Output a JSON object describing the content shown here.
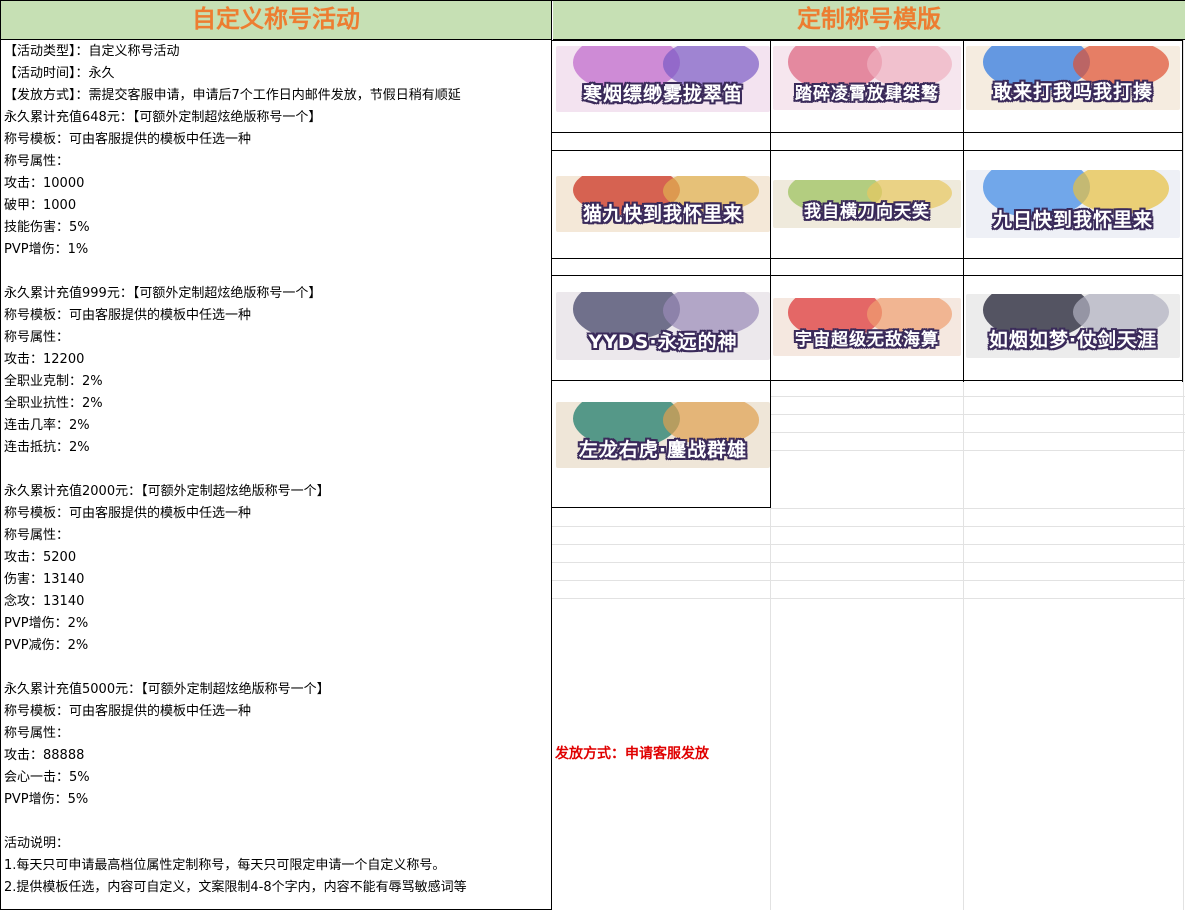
{
  "left_panel": {
    "title": "自定义称号活动",
    "lines": [
      "【活动类型】：自定义称号活动",
      "【活动时间】：永久",
      "【发放方式】：需提交客服申请，申请后7个工作日内邮件发放，节假日稍有顺延",
      "永久累计充值648元：【可额外定制超炫绝版称号一个】",
      "称号模板：可由客服提供的模板中任选一种",
      "称号属性：",
      "攻击：10000",
      "破甲：1000",
      "技能伤害：5%",
      "PVP增伤：1%",
      "",
      "永久累计充值999元：【可额外定制超炫绝版称号一个】",
      "称号模板：可由客服提供的模板中任选一种",
      "称号属性：",
      "攻击：12200",
      "全职业克制：2%",
      "全职业抗性：2%",
      "连击几率：2%",
      "连击抵抗：2%",
      "",
      "永久累计充值2000元：【可额外定制超炫绝版称号一个】",
      "称号模板：可由客服提供的模板中任选一种",
      "称号属性：",
      "攻击：5200",
      "伤害：13140",
      "念攻：13140",
      "PVP增伤：2%",
      "PVP减伤：2%",
      "",
      "永久累计充值5000元：【可额外定制超炫绝版称号一个】",
      "称号模板：可由客服提供的模板中任选一种",
      "称号属性：",
      "攻击：88888",
      "会心一击：5%",
      "PVP增伤：5%",
      "",
      "活动说明：",
      "1.每天只可申请最高档位属性定制称号，每天只可限定申请一个自定义称号。",
      "2.提供模板任选，内容可自定义，文案限制4-8个字内，内容不能有辱骂敏感词等"
    ]
  },
  "right_panel": {
    "title": "定制称号模版",
    "templates": [
      {
        "text": "寒烟缥缈雾拢翠笛",
        "bg": "#f3e3f0",
        "c1": "#c77bd1",
        "c2": "#7a5bc4"
      },
      {
        "text": "踏碎凌霄放肆桀骜",
        "bg": "#f6e6ee",
        "c1": "#e07890",
        "c2": "#f0b0c0"
      },
      {
        "text": "敢来打我吗我打揍",
        "bg": "#f5ece0",
        "c1": "#4a8ae0",
        "c2": "#e05030"
      },
      {
        "text": "猫九快到我怀里来",
        "bg": "#f4e8d8",
        "c1": "#d04a3a",
        "c2": "#e0b050"
      },
      {
        "text": "我自横刀向天笑",
        "bg": "#efeadc",
        "c1": "#a8c870",
        "c2": "#e8c860"
      },
      {
        "text": "九日快到我怀里来",
        "bg": "#eef0f6",
        "c1": "#5a9ae8",
        "c2": "#e8c040"
      },
      {
        "text": "YYDS·永远的神",
        "bg": "#ece8ec",
        "c1": "#5a5a7a",
        "c2": "#9a8ab8"
      },
      {
        "text": "宇宙超级无敌海算",
        "bg": "#f5e8e0",
        "c1": "#e05050",
        "c2": "#f0a070"
      },
      {
        "text": "如烟如梦·仗剑天涯",
        "bg": "#ececec",
        "c1": "#3a3a4a",
        "c2": "#b0b0c0"
      },
      {
        "text": "左龙右虎·鏖战群雄",
        "bg": "#efe6d8",
        "c1": "#3a8a7a",
        "c2": "#e0a050"
      }
    ],
    "note": "发放方式：申请客服发放"
  }
}
